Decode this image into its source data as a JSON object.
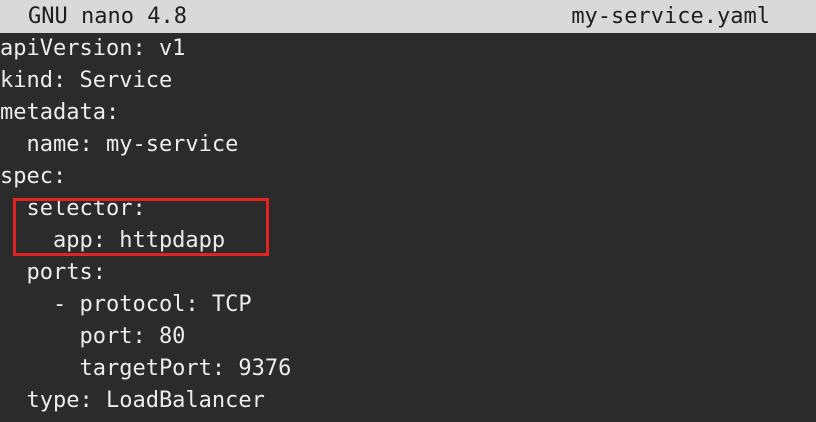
{
  "titlebar": {
    "app_name": "GNU nano 4.8",
    "file_name": "my-service.yaml"
  },
  "editor": {
    "lines": [
      "apiVersion: v1",
      "kind: Service",
      "metadata:",
      "  name: my-service",
      "spec:",
      "  selector:",
      "    app: httpdapp",
      "  ports:",
      "    - protocol: TCP",
      "      port: 80",
      "      targetPort: 9376",
      "  type: LoadBalancer"
    ]
  },
  "annotation": {
    "color": "#e3231f"
  }
}
